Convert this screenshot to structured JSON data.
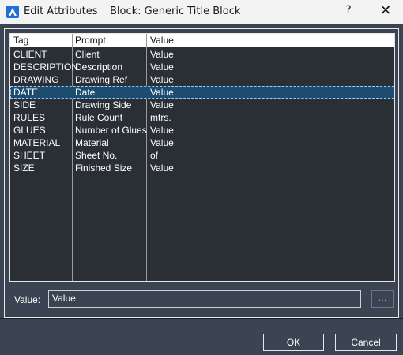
{
  "window": {
    "title": "Edit Attributes",
    "subtitle": "Block: Generic Title Block",
    "help_glyph": "?",
    "close_glyph": "✕",
    "app_icon": "autocad-icon"
  },
  "grid": {
    "columns": [
      "Tag",
      "Prompt",
      "Value"
    ],
    "rows": [
      {
        "tag": "CLIENT",
        "prompt": "Client",
        "value": "Value"
      },
      {
        "tag": "DESCRIPTION",
        "prompt": "Description",
        "value": "Value"
      },
      {
        "tag": "DRAWING",
        "prompt": "Drawing Ref",
        "value": "Value"
      },
      {
        "tag": "DATE",
        "prompt": "Date",
        "value": "Value"
      },
      {
        "tag": "SIDE",
        "prompt": "Drawing Side",
        "value": "Value"
      },
      {
        "tag": "RULES",
        "prompt": "Rule Count",
        "value": "mtrs."
      },
      {
        "tag": "GLUES",
        "prompt": "Number of Glues",
        "value": "Value"
      },
      {
        "tag": "MATERIAL",
        "prompt": "Material",
        "value": "Value"
      },
      {
        "tag": "SHEET",
        "prompt": "Sheet No.",
        "value": "of"
      },
      {
        "tag": "SIZE",
        "prompt": "Finished Size",
        "value": "Value"
      }
    ],
    "selected_index": 3
  },
  "editor": {
    "label": "Value:",
    "value": "Value",
    "browse_label": "..."
  },
  "buttons": {
    "ok": "OK",
    "cancel": "Cancel"
  },
  "colors": {
    "background": "#3b4453",
    "selection": "#1c4c6e"
  }
}
